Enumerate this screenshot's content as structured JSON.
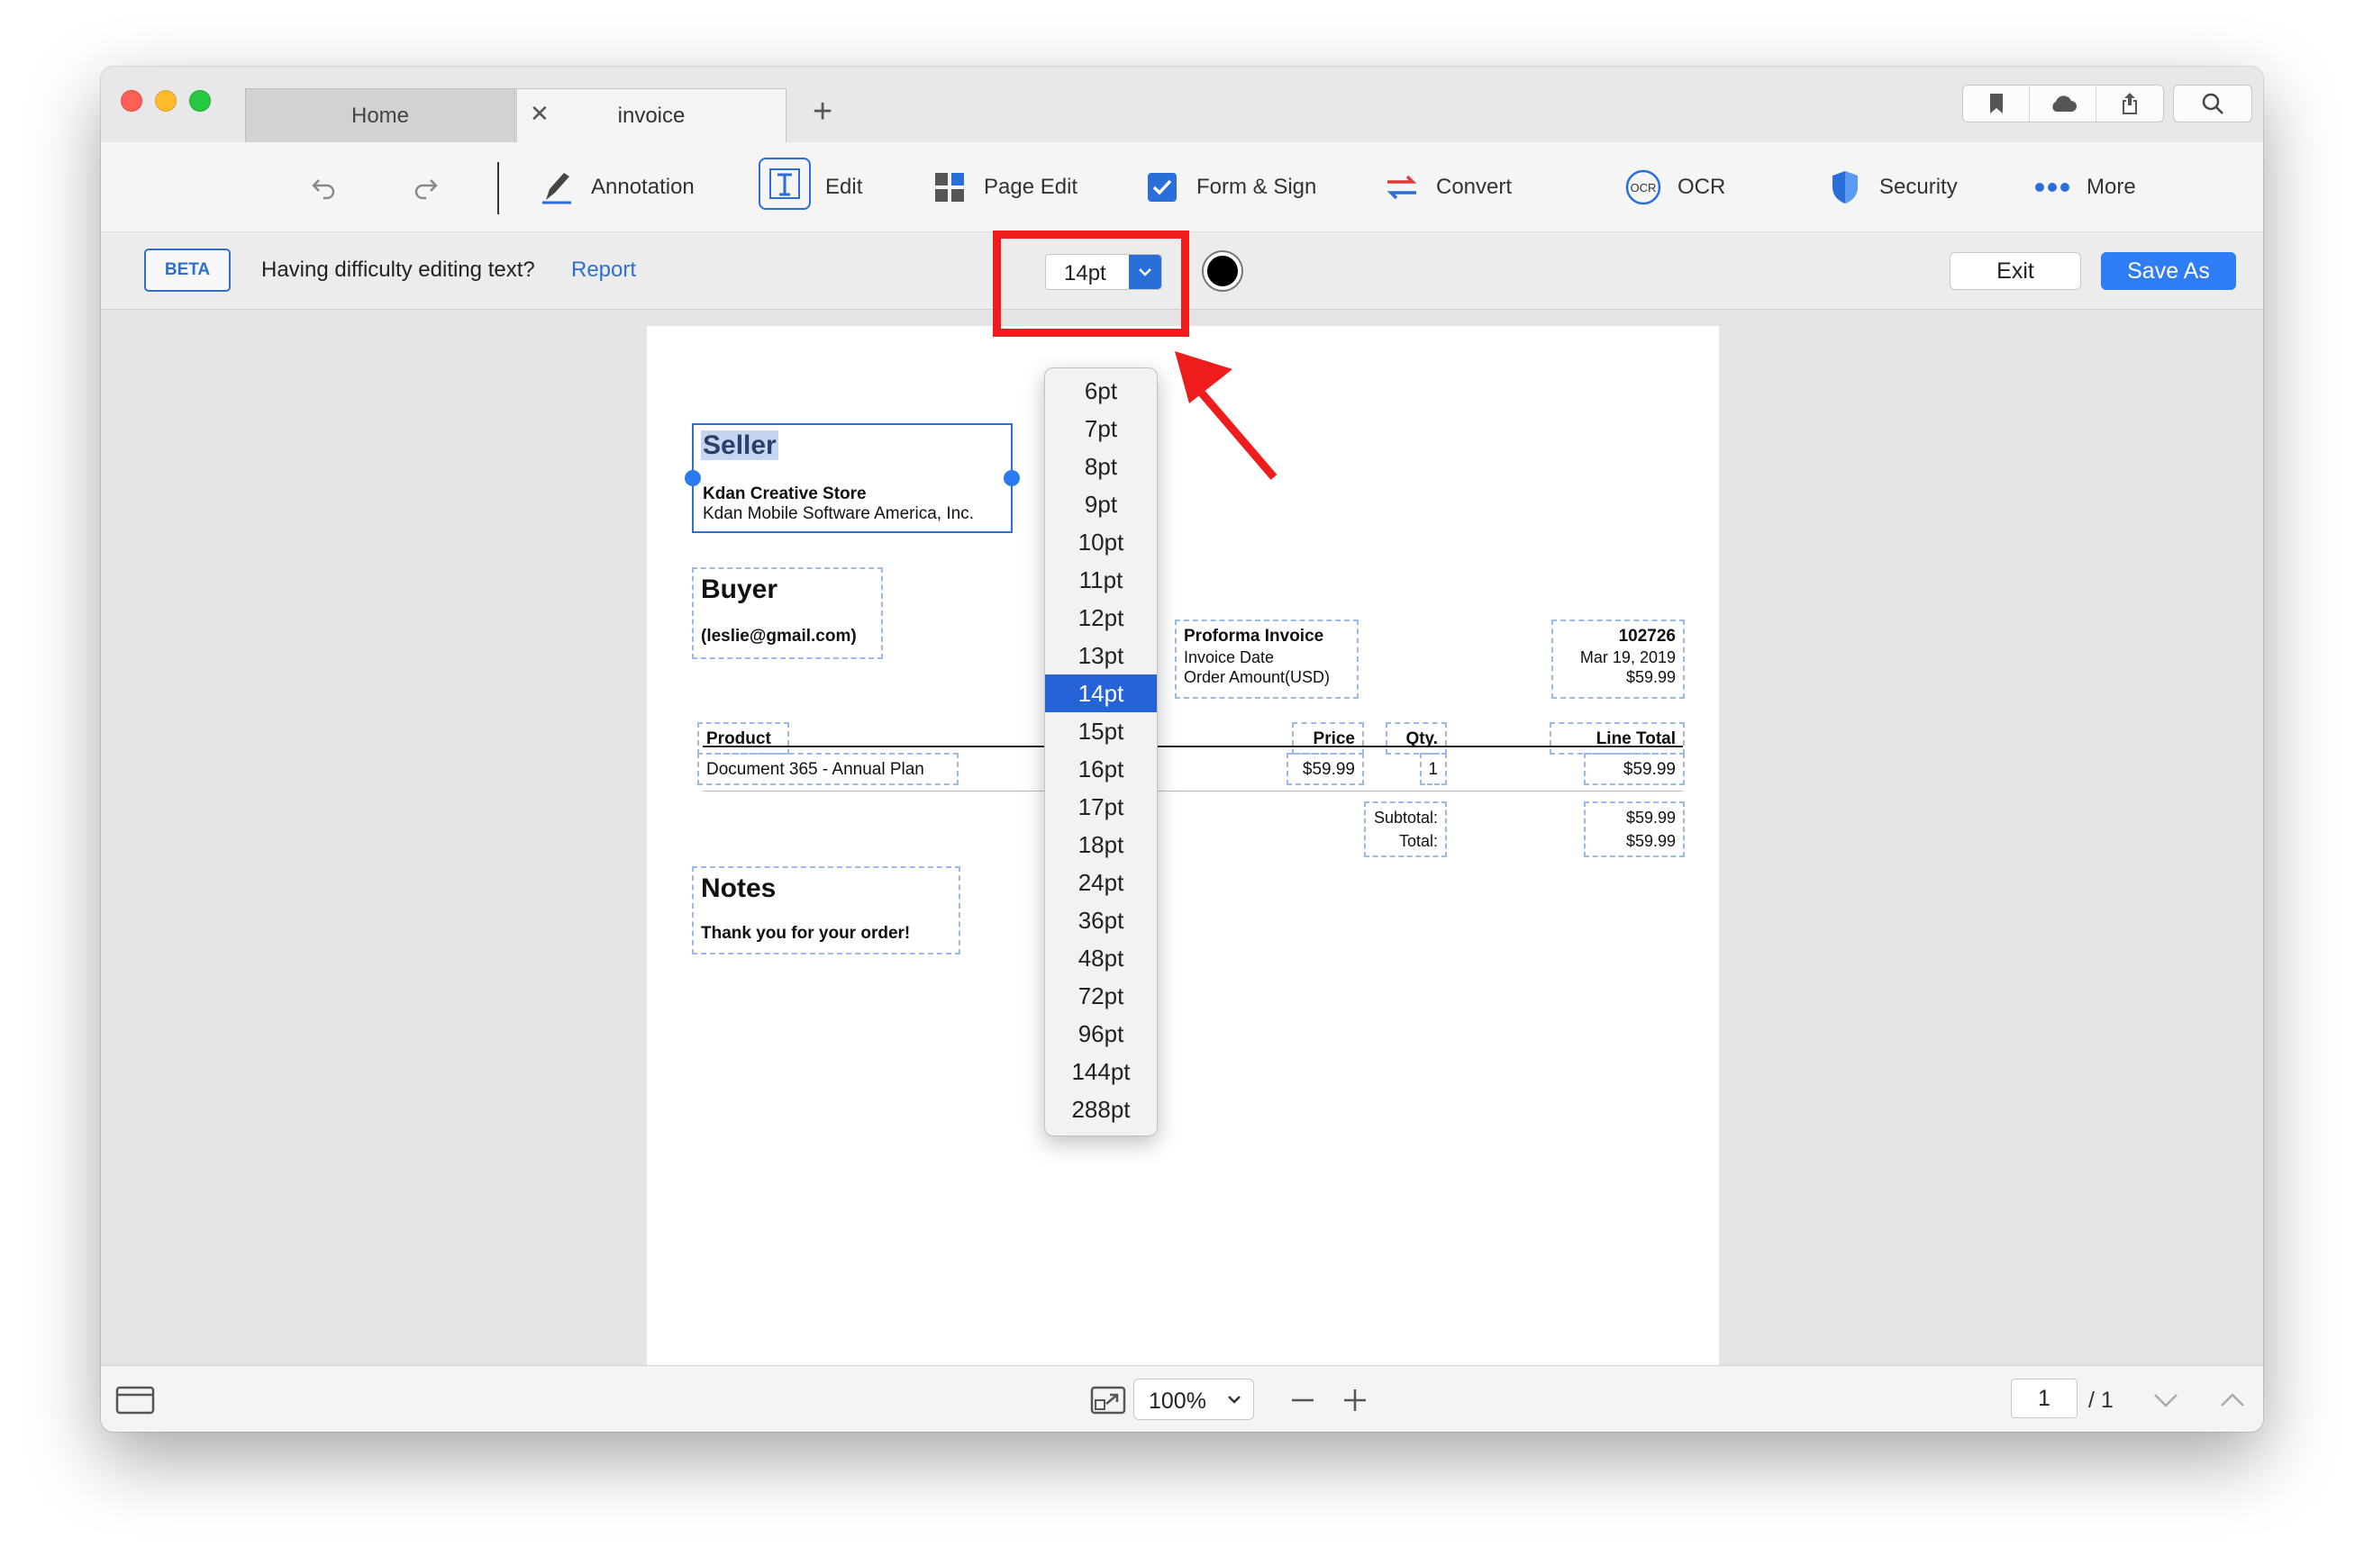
{
  "tabs": [
    {
      "label": "Home"
    },
    {
      "label": "invoice"
    }
  ],
  "toolbar": {
    "annotation": "Annotation",
    "edit": "Edit",
    "page_edit": "Page Edit",
    "form_sign": "Form & Sign",
    "convert": "Convert",
    "ocr": "OCR",
    "security": "Security",
    "more": "More"
  },
  "editbar": {
    "beta": "BETA",
    "difficulty": "Having difficulty editing text?",
    "report": "Report",
    "font_size": "14pt",
    "text_color": "#000000",
    "exit": "Exit",
    "save_as": "Save As"
  },
  "font_sizes": [
    "6pt",
    "7pt",
    "8pt",
    "9pt",
    "10pt",
    "11pt",
    "12pt",
    "13pt",
    "14pt",
    "15pt",
    "16pt",
    "17pt",
    "18pt",
    "24pt",
    "36pt",
    "48pt",
    "72pt",
    "96pt",
    "144pt",
    "288pt"
  ],
  "selected_font_size": "14pt",
  "invoice": {
    "seller_heading": "Seller",
    "seller_name": "Kdan Creative Store",
    "seller_company": "Kdan Mobile Software America, Inc.",
    "buyer_heading": "Buyer",
    "buyer_email": "(leslie@gmail.com)",
    "proforma_title": "Proforma Invoice",
    "invoice_date_label": "Invoice Date",
    "order_amount_label": "Order Amount(USD)",
    "invoice_number": "102726",
    "invoice_date": "Mar 19, 2019",
    "order_amount": "$59.99",
    "col_product": "Product",
    "col_price": "Price",
    "col_qty": "Qty.",
    "col_line_total": "Line Total",
    "row_product": "Document 365 - Annual Plan",
    "row_price": "$59.99",
    "row_qty": "1",
    "row_total": "$59.99",
    "subtotal_label": "Subtotal:",
    "total_label": "Total:",
    "subtotal_value": "$59.99",
    "total_value": "$59.99",
    "notes_heading": "Notes",
    "notes_text": "Thank you for your order!"
  },
  "bottom": {
    "zoom": "100%",
    "current_page": "1",
    "total_pages": "/ 1"
  },
  "colors": {
    "accent": "#2e7cf6",
    "highlight_red": "#ee1c1c"
  }
}
